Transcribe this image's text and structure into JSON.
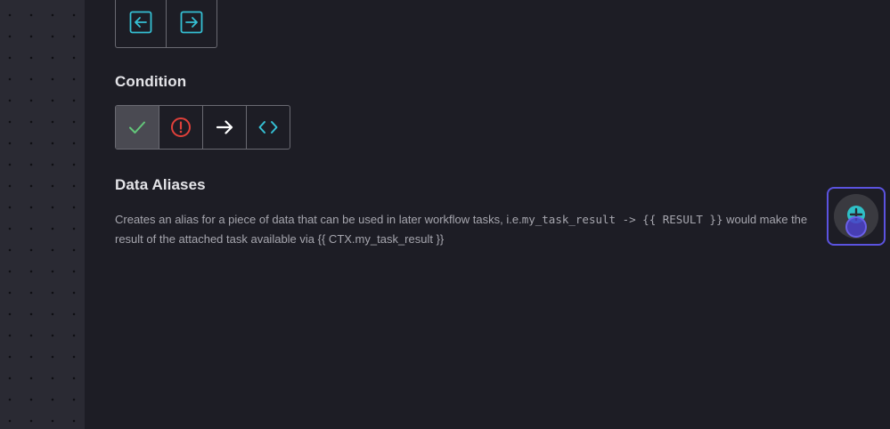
{
  "sidebar_canvas": {},
  "direction_buttons": [
    {
      "icon": "arrow-left-box-icon",
      "color": "#35c0d4"
    },
    {
      "icon": "arrow-right-box-icon",
      "color": "#35c0d4"
    }
  ],
  "condition": {
    "title": "Condition",
    "options": [
      {
        "icon": "check-icon",
        "color": "#63c77a",
        "selected": true
      },
      {
        "icon": "alert-circle-icon",
        "color": "#e0403a",
        "selected": false
      },
      {
        "icon": "arrow-right-icon",
        "color": "#ffffff",
        "selected": false
      },
      {
        "icon": "code-icon",
        "color": "#35c0d4",
        "selected": false
      }
    ]
  },
  "data_aliases": {
    "title": "Data Aliases",
    "desc_prefix": "Creates an alias for a piece of data that can be used in later workflow tasks, i.e.",
    "desc_code": "my_task_result -> {{ RESULT }}",
    "desc_suffix": " would make the result of the attached task available via {{ CTX.my_task_result }}"
  },
  "assistant_button": {
    "icon": "assistant-avatar-icon",
    "border_color": "#5b53e0"
  }
}
